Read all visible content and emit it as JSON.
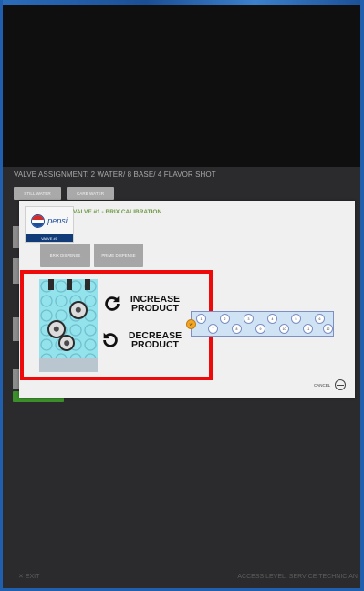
{
  "service_screen": {
    "header": "VALVE ASSIGNMENT: 2 WATER/ 8 BASE/ 4 FLAVOR SHOT",
    "buttons": [
      "STILL WATER",
      "CARB WATER"
    ],
    "exit_label": "EXIT",
    "access_level": "ACCESS LEVEL: SERVICE TECHNICIAN"
  },
  "dialog": {
    "logo": {
      "brand": "pepsi",
      "valve_tag": "VALVE #1"
    },
    "title": "VALVE #1  - BRIX CALIBRATION",
    "tabs": [
      "BRIX DISPENSE",
      "PRIME DISPENSE"
    ],
    "actions": {
      "increase": "INCREASE PRODUCT",
      "decrease": "DECREASE PRODUCT"
    },
    "valve_chain": {
      "current_marker": "W",
      "nodes": [
        "1",
        "2",
        "3",
        "4",
        "5",
        "6",
        "7",
        "8",
        "9",
        "10",
        "11",
        "12"
      ]
    },
    "cancel_label": "CANCEL"
  },
  "colors": {
    "highlight": "#ee0a0a",
    "title_green": "#6f9a48",
    "pepsi_blue": "#123c78",
    "marker_orange": "#f5a522"
  },
  "icons": [
    "clockwise-arrow-icon",
    "counterclockwise-arrow-icon",
    "cancel-icon",
    "pepsi-globe-icon"
  ]
}
